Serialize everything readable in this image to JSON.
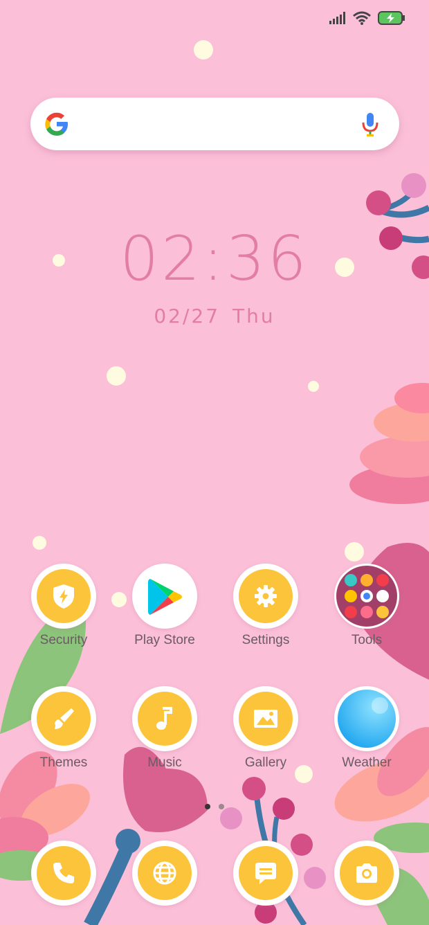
{
  "status_bar": {
    "signal_icon": "signal-icon",
    "wifi_icon": "wifi-icon",
    "battery_icon": "battery-charging-icon"
  },
  "search": {
    "logo_icon": "google-logo-icon",
    "mic_icon": "microphone-icon",
    "placeholder": ""
  },
  "clock": {
    "time": "02:36",
    "date": "02/27",
    "weekday": "Thu"
  },
  "apps_row1": [
    {
      "label": "Security",
      "icon": "shield-bolt-icon"
    },
    {
      "label": "Play Store",
      "icon": "play-store-icon"
    },
    {
      "label": "Settings",
      "icon": "gear-icon"
    },
    {
      "label": "Tools",
      "icon": "folder-icon"
    }
  ],
  "apps_row2": [
    {
      "label": "Themes",
      "icon": "brush-icon"
    },
    {
      "label": "Music",
      "icon": "music-note-icon"
    },
    {
      "label": "Gallery",
      "icon": "image-icon"
    },
    {
      "label": "Weather",
      "icon": "weather-icon"
    }
  ],
  "dock": [
    {
      "icon": "phone-icon"
    },
    {
      "icon": "globe-icon"
    },
    {
      "icon": "message-icon"
    },
    {
      "icon": "camera-icon"
    }
  ],
  "page_indicator": {
    "pages": 2,
    "current": 1
  },
  "colors": {
    "background": "#fbbfd8",
    "accent": "#fcc43b",
    "text": "#e27da6"
  }
}
